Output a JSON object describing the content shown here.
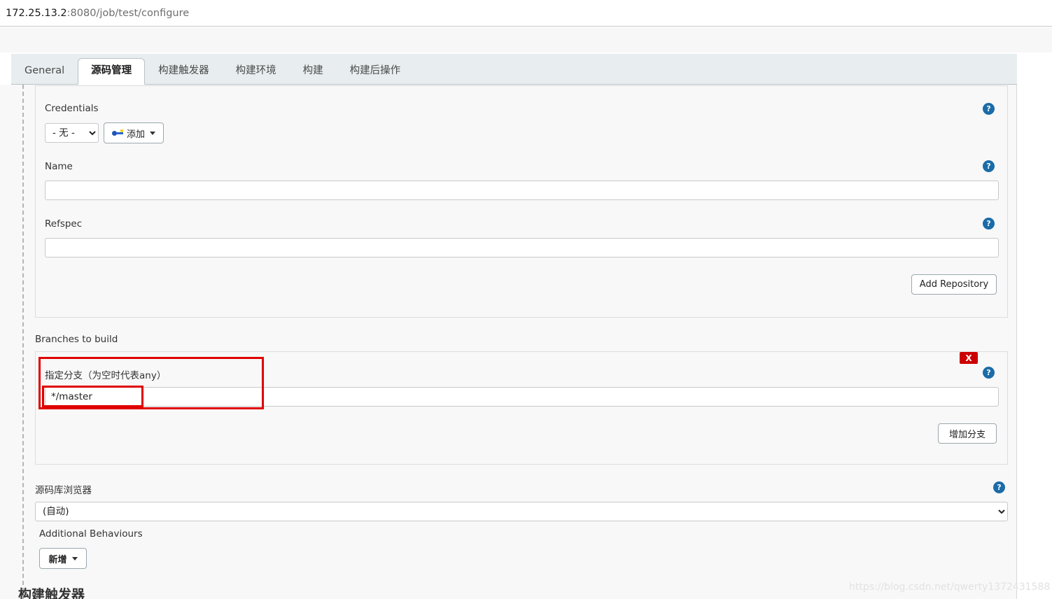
{
  "browser": {
    "url_host": "172.25.13.2",
    "url_path": ":8080/job/test/configure"
  },
  "tabs": [
    {
      "label": "General",
      "active": false
    },
    {
      "label": "源码管理",
      "active": true
    },
    {
      "label": "构建触发器",
      "active": false
    },
    {
      "label": "构建环境",
      "active": false
    },
    {
      "label": "构建",
      "active": false
    },
    {
      "label": "构建后操作",
      "active": false
    }
  ],
  "repository": {
    "credentials_label": "Credentials",
    "credentials_value": "- 无 -",
    "credentials_options": [
      "- 无 -"
    ],
    "add_credentials_label": "添加",
    "name_label": "Name",
    "name_value": "",
    "refspec_label": "Refspec",
    "refspec_value": "",
    "add_repository_label": "Add Repository",
    "help_icon": "?"
  },
  "branches": {
    "section_label": "Branches to build",
    "branch_spec_label": "指定分支（为空时代表any）",
    "branch_spec_value": "*/master",
    "add_branch_label": "增加分支",
    "delete_label": "X",
    "help_icon": "?"
  },
  "browser_section": {
    "label": "源码库浏览器",
    "value": "(自动)",
    "options": [
      "(自动)"
    ],
    "help_icon": "?"
  },
  "additional_behaviours": {
    "label": "Additional Behaviours",
    "add_label": "新增"
  },
  "next_section": {
    "heading": "构建触发器"
  },
  "watermark": {
    "text": "https://blog.csdn.net/qwerty1372431588"
  },
  "colors": {
    "accent_blue": "#1b6ca8",
    "annotation_red": "#e00000",
    "delete_red": "#cc0000",
    "tabbar_bg": "#e8edef",
    "page_bg": "#f8f8f8"
  }
}
